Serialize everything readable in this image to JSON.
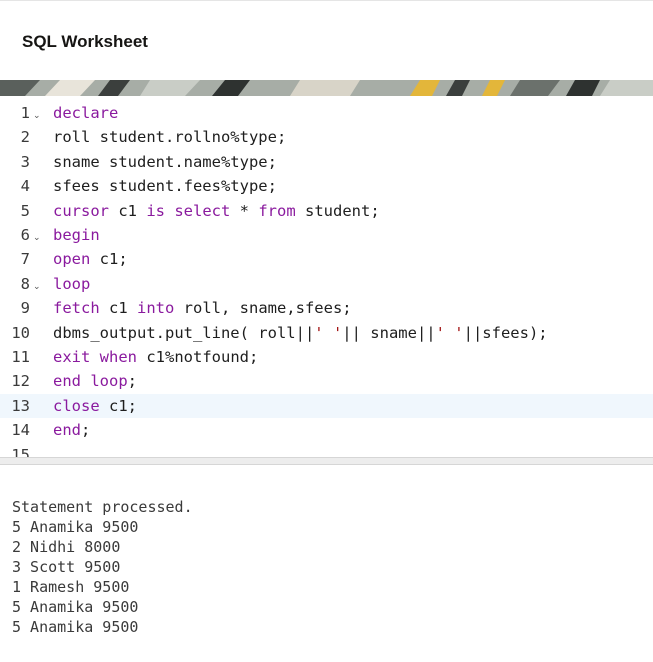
{
  "header": {
    "title": "SQL Worksheet"
  },
  "editor": {
    "active_line": 13,
    "lines": [
      {
        "num": "1",
        "fold": true,
        "tokens": [
          {
            "t": "declare",
            "k": "kw"
          }
        ]
      },
      {
        "num": "2",
        "fold": false,
        "tokens": [
          {
            "t": "roll student.rollno%type;"
          }
        ]
      },
      {
        "num": "3",
        "fold": false,
        "tokens": [
          {
            "t": "sname student.name%type;"
          }
        ]
      },
      {
        "num": "4",
        "fold": false,
        "tokens": [
          {
            "t": "sfees student.fees%type;"
          }
        ]
      },
      {
        "num": "5",
        "fold": false,
        "tokens": [
          {
            "t": "cursor",
            "k": "kw"
          },
          {
            "t": " c1 "
          },
          {
            "t": "is",
            "k": "kw"
          },
          {
            "t": " "
          },
          {
            "t": "select",
            "k": "kw"
          },
          {
            "t": " * "
          },
          {
            "t": "from",
            "k": "kw"
          },
          {
            "t": " student;"
          }
        ]
      },
      {
        "num": "6",
        "fold": true,
        "tokens": [
          {
            "t": "begin",
            "k": "kw"
          }
        ]
      },
      {
        "num": "7",
        "fold": false,
        "tokens": [
          {
            "t": "open",
            "k": "kw"
          },
          {
            "t": " c1;"
          }
        ]
      },
      {
        "num": "8",
        "fold": true,
        "tokens": [
          {
            "t": "loop",
            "k": "kw"
          }
        ]
      },
      {
        "num": "9",
        "fold": false,
        "tokens": [
          {
            "t": "fetch",
            "k": "kw"
          },
          {
            "t": " c1 "
          },
          {
            "t": "into",
            "k": "kw"
          },
          {
            "t": " roll, sname,sfees;"
          }
        ]
      },
      {
        "num": "10",
        "fold": false,
        "tokens": [
          {
            "t": "dbms_output.put_line( roll||"
          },
          {
            "t": "' '",
            "k": "str"
          },
          {
            "t": "|| sname||"
          },
          {
            "t": "' '",
            "k": "str"
          },
          {
            "t": "||sfees);"
          }
        ]
      },
      {
        "num": "11",
        "fold": false,
        "tokens": [
          {
            "t": "exit",
            "k": "kw"
          },
          {
            "t": " "
          },
          {
            "t": "when",
            "k": "kw"
          },
          {
            "t": " c1%notfound;"
          }
        ]
      },
      {
        "num": "12",
        "fold": false,
        "tokens": [
          {
            "t": "end",
            "k": "kw"
          },
          {
            "t": " "
          },
          {
            "t": "loop",
            "k": "kw"
          },
          {
            "t": ";"
          }
        ]
      },
      {
        "num": "13",
        "fold": false,
        "tokens": [
          {
            "t": "close",
            "k": "kw"
          },
          {
            "t": " c1;"
          }
        ]
      },
      {
        "num": "14",
        "fold": false,
        "tokens": [
          {
            "t": "end",
            "k": "kw"
          },
          {
            "t": ";"
          }
        ]
      },
      {
        "num": "15",
        "fold": false,
        "tokens": []
      }
    ],
    "fold_icon": "chevron-down-icon"
  },
  "output": {
    "lines": [
      "Statement processed.",
      "5 Anamika 9500",
      "2 Nidhi 8000",
      "3 Scott 9500",
      "1 Ramesh 9500",
      "5 Anamika 9500",
      "5 Anamika 9500"
    ]
  },
  "colors": {
    "keyword": "#8a1a9e",
    "string": "#a31515",
    "active_line": "#f0f7fd"
  }
}
